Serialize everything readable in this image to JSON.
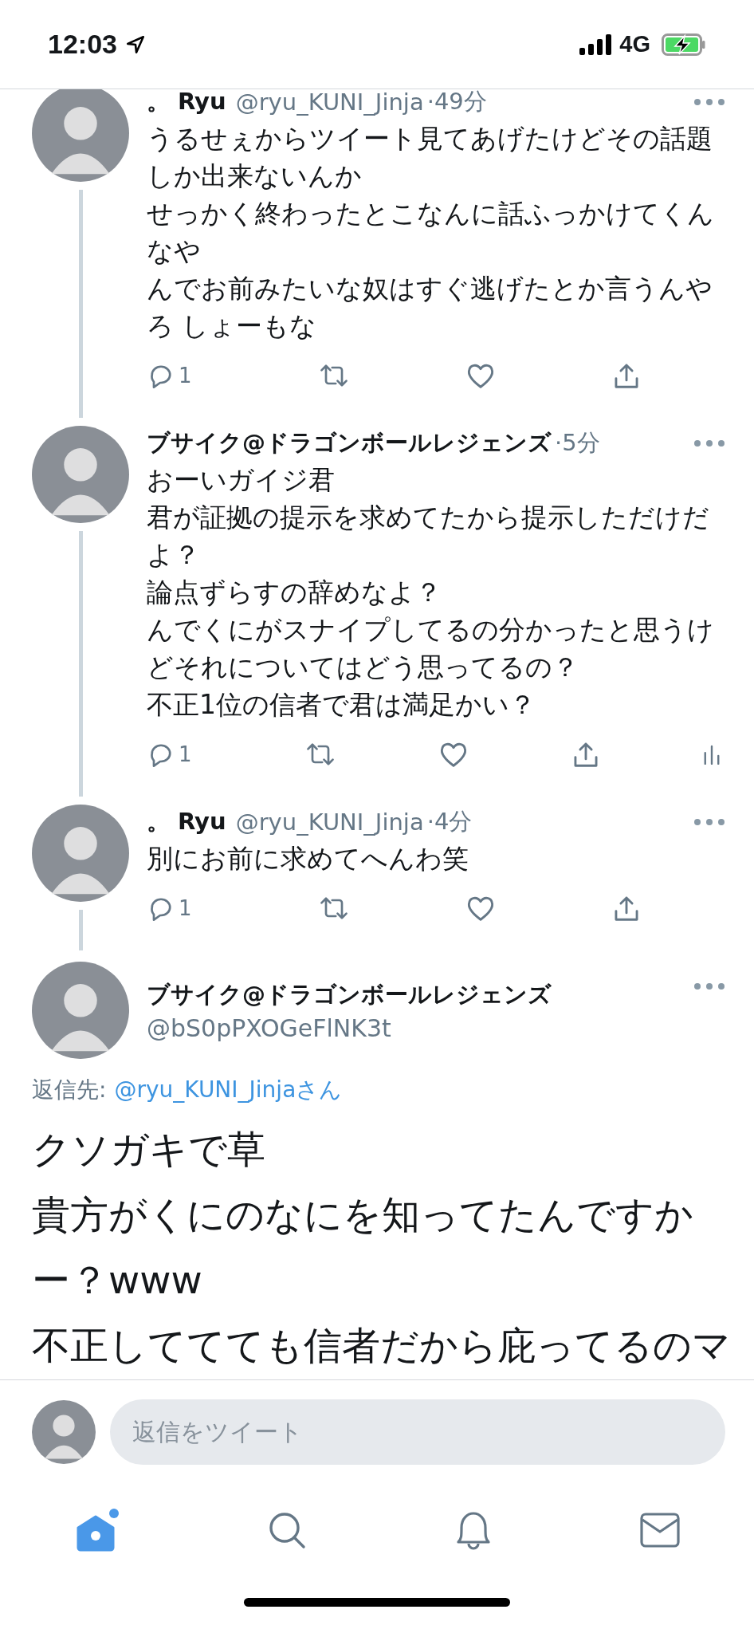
{
  "status_bar": {
    "time": "12:03",
    "network": "4G",
    "charging": true
  },
  "thread": [
    {
      "name": "。 Ryu",
      "handle": "@ryu_KUNI_Jinja",
      "time": "·49分",
      "continues": true,
      "lines": [
        "うるせぇからツイート見てあげたけどその話題",
        "しか出来ないんか",
        "せっかく終わったとこなんに話ふっかけてくん",
        "なや",
        "んでお前みたいな奴はすぐ逃げたとか言うんや",
        "ろ しょーもな"
      ],
      "replies": "1",
      "analytics": false
    },
    {
      "name": "ブサイク@ドラゴンボールレジェンズ",
      "time": "·5分",
      "continues": true,
      "lines": [
        "おーいガイジ君",
        "君が証拠の提示を求めてたから提示しただけだ",
        "よ？",
        "論点ずらすの辞めなよ？",
        "んでくにがスナイプしてるの分かったと思うけ",
        "どそれについてはどう思ってるの？",
        "不正1位の信者で君は満足かい？"
      ],
      "replies": "1",
      "analytics": true
    },
    {
      "name": "。 Ryu",
      "handle": "@ryu_KUNI_Jinja",
      "time": "·4分",
      "continues": true,
      "lines": [
        "別にお前に求めてへんわ笑"
      ],
      "replies": "1",
      "analytics": false
    }
  ],
  "main_tweet": {
    "name": "ブサイク@ドラゴンボールレジェンズ",
    "handle": "@bS0pPXOGeFlNK3t",
    "reply_to_label": "返信先:",
    "reply_to": "@ryu_KUNI_Jinjaさん",
    "lines": [
      "クソガキで草",
      "貴方がくにのなにを知ってたんですか",
      "ー？www",
      "不正しててても信者だから庇ってるのマ"
    ]
  },
  "reply_bar": {
    "placeholder": "返信をツイート"
  },
  "tab_bar": [
    {
      "kind": "home",
      "selected": true,
      "badge": true
    },
    {
      "kind": "search",
      "selected": false,
      "badge": false
    },
    {
      "kind": "notifications",
      "selected": false,
      "badge": false
    },
    {
      "kind": "messages",
      "selected": false,
      "badge": false
    }
  ]
}
